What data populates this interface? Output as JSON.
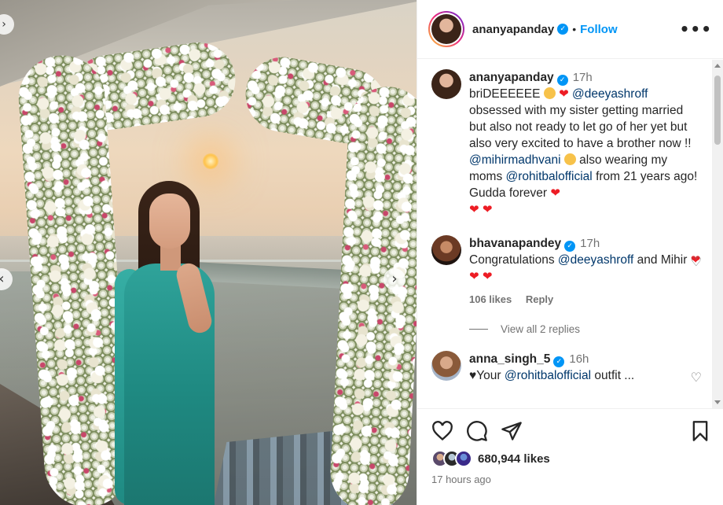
{
  "post": {
    "username": "ananyapanday",
    "follow_label": "Follow",
    "separator": "•",
    "more_label": "•••"
  },
  "photo": {
    "next_label": "›",
    "prev_label": "‹"
  },
  "caption": {
    "username": "ananyapanday",
    "time": "17h",
    "segments": {
      "s1": "briDEEEEEE",
      "m1": "@deeyashroff",
      "s2": "obsessed with my sister getting married but also not ready to let go of her yet but also very excited to have a brother now !!",
      "m2": "@mihirmadhvani",
      "s3": "also wearing my moms",
      "m3": "@rohitbalofficial",
      "s4": "from 21 years ago! Gudda forever"
    }
  },
  "comments": [
    {
      "username": "bhavanapandey",
      "time": "17h",
      "text_a": "Congratulations",
      "mention": "@deeyashroff",
      "text_b": "and Mihir",
      "likes": "106 likes",
      "reply_label": "Reply",
      "view_replies": "View all 2 replies"
    },
    {
      "username": "anna_singh_5",
      "time": "16h",
      "text_a": "♥Your",
      "mention": "@rohitbalofficial",
      "text_b": "outfit ..."
    }
  ],
  "footer": {
    "likes_count": "680,944 likes",
    "time_ago": "17 hours ago"
  },
  "icons": {
    "verified": "verified-badge-icon",
    "heart": "heart-icon",
    "comment": "comment-icon",
    "share": "share-icon",
    "bookmark": "bookmark-icon"
  },
  "colors": {
    "accent": "#0095f6",
    "mention": "#00376b",
    "heart": "#ed1c24",
    "muted": "#737373"
  }
}
